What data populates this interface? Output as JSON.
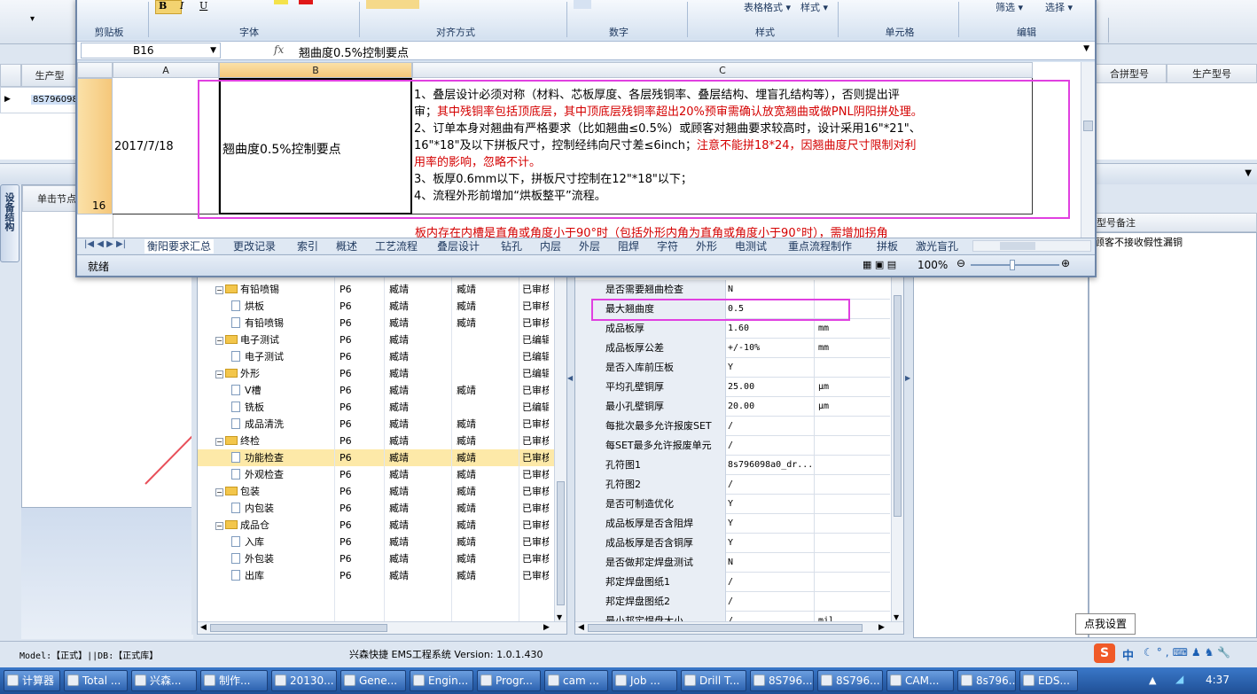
{
  "main_bg_header": {
    "left_headers": [
      "生产型"
    ],
    "left_row": "8S796098",
    "right_headers": [
      "合拼型号",
      "生产型号"
    ],
    "note_header": "型号备注",
    "note_text": "顾客不接收假性漏铜",
    "click_node_tab": "单击节点",
    "vertical_tab": "设备结构"
  },
  "excel": {
    "ribbon_groups": [
      "剪贴板",
      "字体",
      "对齐方式",
      "数字",
      "样式",
      "单元格",
      "编辑"
    ],
    "ribbon_buttons": [
      "表格格式",
      "样式",
      "筛选",
      "选择"
    ],
    "cell_ref": "B16",
    "fx": "fx",
    "formula_text": "翘曲度0.5%控制要点",
    "columns": [
      "A",
      "B",
      "C"
    ],
    "row_number": "16",
    "date": "2017/7/18",
    "title_cell": "翘曲度0.5%控制要点",
    "c_lines": [
      [
        {
          "t": "1、叠层设计必须对称（材料、芯板厚度、各层残铜率、叠层结构、埋盲孔结构等），否则提出评",
          "red": false
        }
      ],
      [
        {
          "t": "审；",
          "red": false
        },
        {
          "t": "其中残铜率包括顶底层，其中顶底层残铜率超出20%预审需确认放宽翘曲或做PNL阴阳拼处理。",
          "red": true
        }
      ],
      [
        {
          "t": "2、订单本身对翘曲有严格要求（比如翘曲≤0.5%）或顾客对翘曲要求较高时，设计采用16\"*21\"、",
          "red": false
        }
      ],
      [
        {
          "t": "16\"*18\"及以下拼板尺寸，控制经纬向尺寸差≤6inch；",
          "red": false
        },
        {
          "t": "注意不能拼18*24，因翘曲度尺寸限制对利",
          "red": true
        }
      ],
      [
        {
          "t": "用率的影响，忽略不计。",
          "red": true
        }
      ],
      [
        {
          "t": "3、板厚0.6mm以下，拼板尺寸控制在12\"*18\"以下；",
          "red": false
        }
      ],
      [
        {
          "t": "4、流程外形前增加“烘板整平”流程。",
          "red": false
        }
      ]
    ],
    "next_row_text": "板内存在内槽是直角或角度小于90°时（包括外形内角为直角或角度小于90°时），需增加拐角",
    "sheet_tabs": [
      "衡阳要求汇总",
      "更改记录",
      "索引",
      "概述",
      "工艺流程",
      "叠层设计",
      "钻孔",
      "内层",
      "外层",
      "阻焊",
      "字符",
      "外形",
      "电测试",
      "重点流程制作",
      "拼板",
      "激光盲孔"
    ],
    "status": "就绪",
    "zoom": "100%"
  },
  "tree": {
    "rows": [
      {
        "label": "有铅喷锡",
        "level": 1,
        "folder": true,
        "c2": "P6",
        "c3": "臧靖",
        "c4": "臧靖",
        "c5": "已审核",
        "sel": false
      },
      {
        "label": "烘板",
        "level": 2,
        "folder": false,
        "c2": "P6",
        "c3": "臧靖",
        "c4": "臧靖",
        "c5": "已审核",
        "sel": false
      },
      {
        "label": "有铅喷锡",
        "level": 2,
        "folder": false,
        "c2": "P6",
        "c3": "臧靖",
        "c4": "臧靖",
        "c5": "已审核",
        "sel": false
      },
      {
        "label": "电子测试",
        "level": 1,
        "folder": true,
        "c2": "P6",
        "c3": "臧靖",
        "c4": "",
        "c5": "已编辑",
        "sel": false
      },
      {
        "label": "电子测试",
        "level": 2,
        "folder": false,
        "c2": "P6",
        "c3": "臧靖",
        "c4": "",
        "c5": "已编辑",
        "sel": false
      },
      {
        "label": "外形",
        "level": 1,
        "folder": true,
        "c2": "P6",
        "c3": "臧靖",
        "c4": "",
        "c5": "已编辑",
        "sel": false
      },
      {
        "label": "V槽",
        "level": 2,
        "folder": false,
        "c2": "P6",
        "c3": "臧靖",
        "c4": "臧靖",
        "c5": "已审核",
        "sel": false
      },
      {
        "label": "铣板",
        "level": 2,
        "folder": false,
        "c2": "P6",
        "c3": "臧靖",
        "c4": "",
        "c5": "已编辑",
        "sel": false
      },
      {
        "label": "成品清洗",
        "level": 2,
        "folder": false,
        "c2": "P6",
        "c3": "臧靖",
        "c4": "臧靖",
        "c5": "已审核",
        "sel": false
      },
      {
        "label": "终检",
        "level": 1,
        "folder": true,
        "c2": "P6",
        "c3": "臧靖",
        "c4": "臧靖",
        "c5": "已审核",
        "sel": false
      },
      {
        "label": "功能检查",
        "level": 2,
        "folder": false,
        "c2": "P6",
        "c3": "臧靖",
        "c4": "臧靖",
        "c5": "已审核",
        "sel": true
      },
      {
        "label": "外观检查",
        "level": 2,
        "folder": false,
        "c2": "P6",
        "c3": "臧靖",
        "c4": "臧靖",
        "c5": "已审核",
        "sel": false
      },
      {
        "label": "包装",
        "level": 1,
        "folder": true,
        "c2": "P6",
        "c3": "臧靖",
        "c4": "臧靖",
        "c5": "已审核",
        "sel": false
      },
      {
        "label": "内包装",
        "level": 2,
        "folder": false,
        "c2": "P6",
        "c3": "臧靖",
        "c4": "臧靖",
        "c5": "已审核",
        "sel": false
      },
      {
        "label": "成品仓",
        "level": 1,
        "folder": true,
        "c2": "P6",
        "c3": "臧靖",
        "c4": "臧靖",
        "c5": "已审核",
        "sel": false
      },
      {
        "label": "入库",
        "level": 2,
        "folder": false,
        "c2": "P6",
        "c3": "臧靖",
        "c4": "臧靖",
        "c5": "已审核",
        "sel": false
      },
      {
        "label": "外包装",
        "level": 2,
        "folder": false,
        "c2": "P6",
        "c3": "臧靖",
        "c4": "臧靖",
        "c5": "已审核",
        "sel": false
      },
      {
        "label": "出库",
        "level": 2,
        "folder": false,
        "c2": "P6",
        "c3": "臧靖",
        "c4": "臧靖",
        "c5": "已审核",
        "sel": false
      }
    ]
  },
  "props": {
    "rows": [
      {
        "name": "是否需要翘曲检查",
        "value": "N",
        "unit": ""
      },
      {
        "name": "最大翘曲度",
        "value": "0.5",
        "unit": ""
      },
      {
        "name": "成品板厚",
        "value": "1.60",
        "unit": "mm"
      },
      {
        "name": "成品板厚公差",
        "value": "+/-10%",
        "unit": "mm"
      },
      {
        "name": "是否入库前压板",
        "value": "Y",
        "unit": ""
      },
      {
        "name": "平均孔壁铜厚",
        "value": "25.00",
        "unit": "μm"
      },
      {
        "name": "最小孔壁铜厚",
        "value": "20.00",
        "unit": "μm"
      },
      {
        "name": "每批次最多允许报废SET",
        "value": "/",
        "unit": ""
      },
      {
        "name": "每SET最多允许报废单元",
        "value": "/",
        "unit": ""
      },
      {
        "name": "孔符图1",
        "value": "8s796098a0_dr...",
        "unit": ""
      },
      {
        "name": "孔符图2",
        "value": "/",
        "unit": ""
      },
      {
        "name": "是否可制造优化",
        "value": "Y",
        "unit": ""
      },
      {
        "name": "成品板厚是否含阻焊",
        "value": "Y",
        "unit": ""
      },
      {
        "name": "成品板厚是否含铜厚",
        "value": "Y",
        "unit": ""
      },
      {
        "name": "是否做邦定焊盘测试",
        "value": "N",
        "unit": ""
      },
      {
        "name": "邦定焊盘图纸1",
        "value": "/",
        "unit": ""
      },
      {
        "name": "邦定焊盘图纸2",
        "value": "/",
        "unit": ""
      },
      {
        "name": "最小邦定焊盘大小",
        "value": "/",
        "unit": "mil"
      }
    ]
  },
  "status_bar": {
    "left": "Model:【正式】||DB:【正式库】",
    "center": "兴森快捷 EMS工程系统 Version: 1.0.1.430",
    "tooltip": "点我设置"
  },
  "taskbar": {
    "items": [
      "计算器",
      "Total ...",
      "兴森...",
      "制作...",
      "20130...",
      "Gene...",
      "Engin...",
      "Progr...",
      "cam ...",
      "Job ...",
      "Drill T...",
      "8S796...",
      "8S796...",
      "CAM...",
      "8s796...",
      "EDS..."
    ],
    "tray_ime": "中",
    "clock": "4:37"
  },
  "colors": {
    "highlight_box": "#e040e0",
    "red_text": "#d40000",
    "selected_row": "#fde9a8"
  }
}
